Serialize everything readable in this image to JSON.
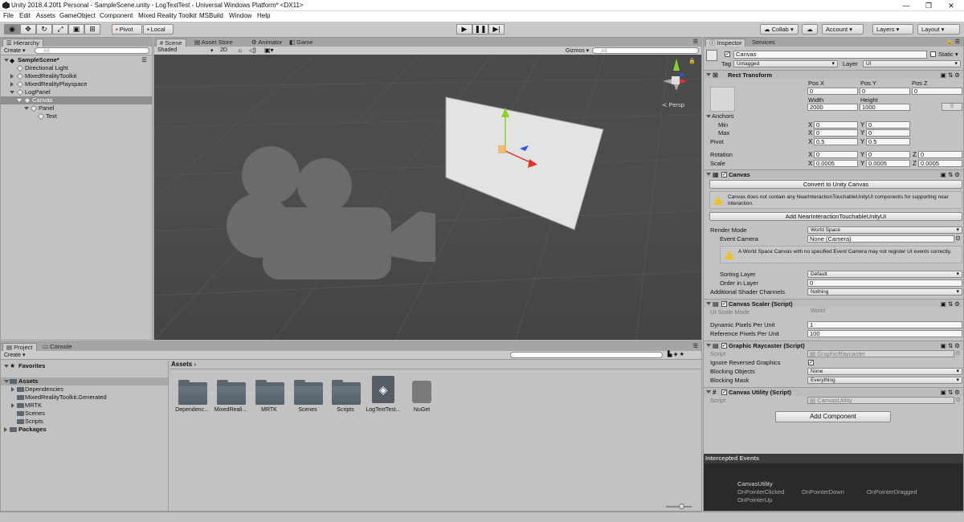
{
  "window": {
    "title": "Unity 2018.4.20f1 Personal - SampleScene.unity - LogTextTest - Universal Windows Platform* <DX11>",
    "minimize": "—",
    "maximize": "❐",
    "close": "✕"
  },
  "menu": [
    "File",
    "Edit",
    "Assets",
    "GameObject",
    "Component",
    "Mixed Reality Toolkit",
    "MSBuild",
    "Window",
    "Help"
  ],
  "toolbar": {
    "pivot": "Pivot",
    "local": "Local",
    "collab": "Collab",
    "account": "Account",
    "layers": "Layers",
    "layout": "Layout"
  },
  "hierarchy": {
    "tab": "Hierarchy",
    "create": "Create",
    "search_placeholder": "All",
    "items": [
      {
        "label": "SampleScene*"
      },
      {
        "label": "Directional Light"
      },
      {
        "label": "MixedRealityToolkit"
      },
      {
        "label": "MixedRealityPlayspace"
      },
      {
        "label": "LogPanel"
      },
      {
        "label": "Canvas"
      },
      {
        "label": "Panel"
      },
      {
        "label": "Text"
      }
    ]
  },
  "scene": {
    "tabs": [
      "Scene",
      "Asset Store",
      "Animator",
      "Game"
    ],
    "shading": "Shaded",
    "mode2d": "2D",
    "gizmos": "Gizmos",
    "search_placeholder": "All",
    "persp": "Persp"
  },
  "project": {
    "tabs": [
      "Project",
      "Console"
    ],
    "create": "Create",
    "favorites": "Favorites",
    "assets_root": "Assets",
    "tree": [
      "Dependencies",
      "MixedRealityToolkit.Generated",
      "MRTK",
      "Scenes",
      "Scripts"
    ],
    "packages": "Packages",
    "breadcrumb": "Assets",
    "assets": [
      "Dependenc...",
      "MixedReali...",
      "MRTK",
      "Scenes",
      "Scripts",
      "LogTextTest...",
      "NuGet"
    ]
  },
  "inspector": {
    "tabs": [
      "Inspector",
      "Services"
    ],
    "object_name": "Canvas",
    "static": "Static",
    "tag_label": "Tag",
    "tag": "Untagged",
    "layer_label": "Layer",
    "layer": "UI",
    "rect": {
      "title": "Rect Transform",
      "posx_label": "Pos X",
      "posy_label": "Pos Y",
      "posz_label": "Pos Z",
      "posx": "0",
      "posy": "0",
      "posz": "0",
      "width_label": "Width",
      "height_label": "Height",
      "width": "2000",
      "height": "1000",
      "anchors": "Anchors",
      "min": "Min",
      "max": "Max",
      "pivot": "Pivot",
      "rotation": "Rotation",
      "scale": "Scale",
      "x": "X",
      "y": "Y",
      "z": "Z",
      "min_x": "0",
      "min_y": "0",
      "max_x": "0",
      "max_y": "0",
      "pivot_x": "0.5",
      "pivot_y": "0.5",
      "rot_x": "0",
      "rot_y": "0",
      "rot_z": "0",
      "scale_x": "0.0005",
      "scale_y": "0.0005",
      "scale_z": "0.0005"
    },
    "canvas": {
      "title": "Canvas",
      "convert_btn": "Convert to Unity Canvas",
      "warn1": "Canvas does not contain any NearInteractionTouchableUnityUI components for supporting near interaction.",
      "add_btn": "Add NearInteractionTouchableUnityUI",
      "render_mode_label": "Render Mode",
      "render_mode": "World Space",
      "event_camera_label": "Event Camera",
      "event_camera": "None (Camera)",
      "warn2": "A World Space Canvas with no specified Event Camera may not register UI events correctly.",
      "sorting_layer_label": "Sorting Layer",
      "sorting_layer": "Default",
      "order_label": "Order in Layer",
      "order": "0",
      "shader_label": "Additional Shader Channels",
      "shader": "Nothing"
    },
    "scaler": {
      "title": "Canvas Scaler (Script)",
      "ui_scale_label": "UI Scale Mode",
      "ui_scale": "World",
      "dyn_label": "Dynamic Pixels Per Unit",
      "dyn": "1",
      "ref_label": "Reference Pixels Per Unit",
      "ref": "100"
    },
    "raycaster": {
      "title": "Graphic Raycaster (Script)",
      "script_label": "Script",
      "script": "GraphicRaycaster",
      "ignore_label": "Ignore Reversed Graphics",
      "blocking_obj_label": "Blocking Objects",
      "blocking_obj": "None",
      "blocking_mask_label": "Blocking Mask",
      "blocking_mask": "Everything"
    },
    "utility": {
      "title": "Canvas Utility (Script)",
      "script_label": "Script",
      "script": "CanvasUtility"
    },
    "add_component": "Add Component",
    "events": {
      "title": "Intercepted Events",
      "name": "CanvasUtility",
      "items": [
        "OnPointerClicked",
        "OnPointerDown",
        "OnPointerDragged",
        "OnPointerUp"
      ]
    }
  },
  "colors": {
    "selection": "#8f8f8f",
    "scene_bg": "#4a4a4a",
    "events_bg": "#2a2a2a"
  }
}
